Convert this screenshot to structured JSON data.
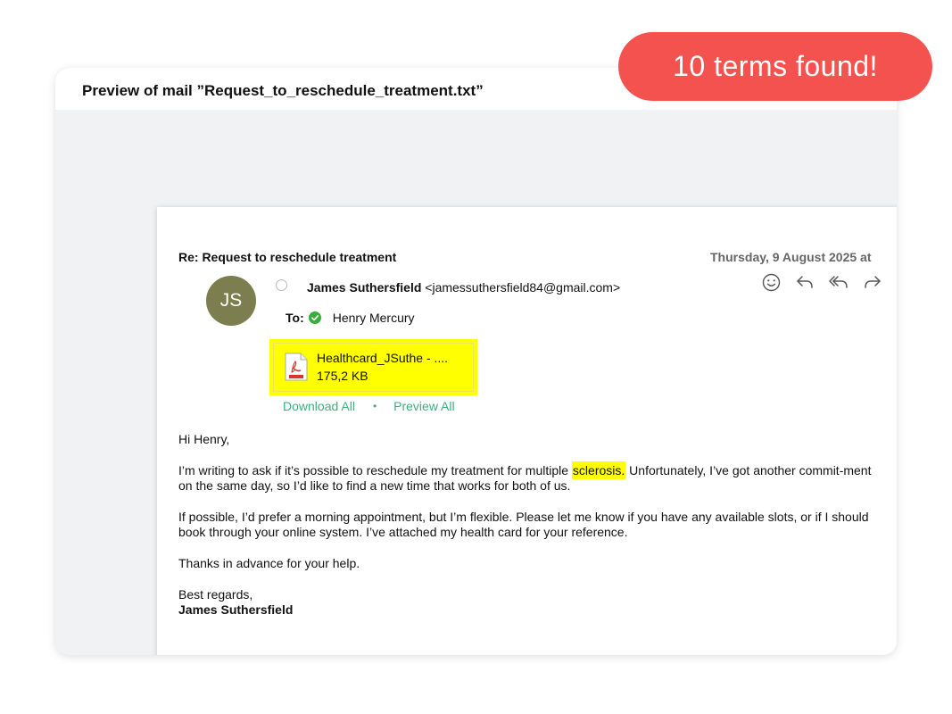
{
  "window": {
    "title": "Preview of mail ”Request_to_reschedule_treatment.txt”"
  },
  "badge": {
    "text": "10 terms found!",
    "color": "#f4524f"
  },
  "mail": {
    "subject": "Re: Request to reschedule treatment",
    "date": "Thursday, 9 August 2025 at",
    "avatar_initials": "JS",
    "avatar_color": "#7d7e4f",
    "sender_name": "James Suthersfield",
    "sender_email": "<jamessuthersfield84@gmail.com>",
    "to_label": "To:",
    "to_name": "Henry Mercury",
    "actions": [
      "smiley-icon",
      "reply-icon",
      "reply-all-icon",
      "forward-icon"
    ],
    "attachment": {
      "name": "Healthcard_JSuthe - ....",
      "size": "175,2 KB",
      "icon": "pdf-file-icon",
      "highlight_color": "#ffff00"
    },
    "download_all": "Download All",
    "separator": "•",
    "preview_all": "Preview All",
    "link_color": "#3fae7f",
    "body": {
      "greeting": "Hi Henry,",
      "p1_before": "I’m writing to ask if it’s possible to reschedule my treatment for multiple ",
      "p1_highlight": "sclerosis.",
      "p1_after": " Unfortunately, I’ve got another commit-ment on the same day, so I’d like to find a new time that works for both of us.",
      "p2": "If possible, I’d prefer a morning appointment, but I’m flexible. Please let me know if you have any available slots, or if I should book through your online system. I’ve attached my health card for your reference.",
      "p3": "Thanks in advance for your help.",
      "closing": "Best regards,",
      "signature": "James Suthersfield"
    }
  }
}
